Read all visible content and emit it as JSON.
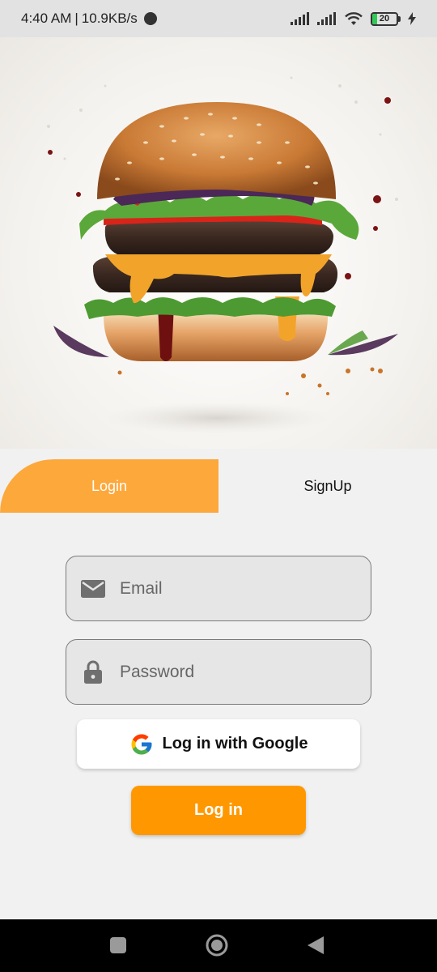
{
  "status_bar": {
    "time": "4:40 AM",
    "separator": "|",
    "network_speed": "10.9KB/s",
    "battery_level": "20",
    "battery_fraction": 0.2,
    "icons": [
      "vpn-icon",
      "signal-icon",
      "signal-icon",
      "wifi-icon",
      "battery-icon",
      "charging-icon"
    ]
  },
  "hero": {
    "image": "burger-image"
  },
  "tabs": [
    {
      "label": "Login",
      "active": true
    },
    {
      "label": "SignUp",
      "active": false
    }
  ],
  "form": {
    "email": {
      "placeholder": "Email",
      "value": "",
      "icon": "mail-icon"
    },
    "password": {
      "placeholder": "Password",
      "value": "",
      "icon": "lock-icon"
    },
    "google_button": {
      "label": "Log in with Google",
      "icon": "google-icon"
    },
    "login_button": {
      "label": "Log in"
    }
  },
  "nav_bar": {
    "icons": [
      "recents-icon",
      "home-icon",
      "back-icon"
    ]
  },
  "colors": {
    "accent": "#ff9800",
    "tab_active": "#fda83b",
    "background": "#f1f1f1",
    "field_bg": "#e6e6e6"
  }
}
